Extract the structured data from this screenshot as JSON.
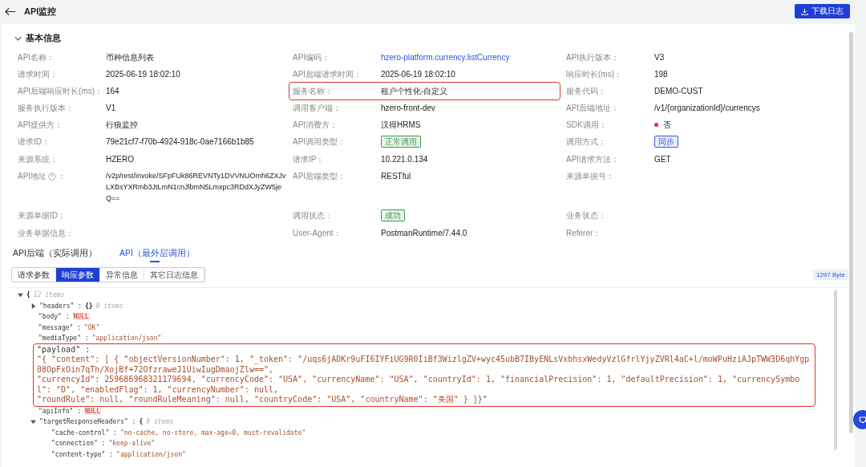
{
  "header": {
    "title": "API监控",
    "download_button": "下载日志"
  },
  "section": {
    "title": "基本信息",
    "expanded": true
  },
  "fields": [
    {
      "label": "API名称：",
      "value": "币种信息列表",
      "kind": "text"
    },
    {
      "label": "API编码：",
      "value": "hzero-platform.currency.listCurrency",
      "kind": "link"
    },
    {
      "label": "API执行版本：",
      "value": "V3",
      "kind": "text"
    },
    {
      "label": "请求时间：",
      "value": "2025-06-19 18:02:10",
      "kind": "text"
    },
    {
      "label": "API后端请求时间：",
      "value": "2025-06-19 18:02:10",
      "kind": "text"
    },
    {
      "label": "响应时长(ms)：",
      "value": "198",
      "kind": "text"
    },
    {
      "label": "API后端响应时长(ms)：",
      "value": "164",
      "kind": "text"
    },
    {
      "label": "服务名称：",
      "value": "租户个性化-自定义",
      "kind": "text",
      "highlighted": true
    },
    {
      "label": "服务代码：",
      "value": "DEMO-CUST",
      "kind": "text"
    },
    {
      "label": "服务执行版本：",
      "value": "V1",
      "kind": "text"
    },
    {
      "label": "调用客户端：",
      "value": "hzero-front-dev",
      "kind": "text"
    },
    {
      "label": "API后端地址：",
      "value": "/v1/{organizationId}/currencys",
      "kind": "text"
    },
    {
      "label": "API提供方：",
      "value": "行狼监控",
      "kind": "text"
    },
    {
      "label": "API消费方：",
      "value": "汉得HRMS",
      "kind": "text"
    },
    {
      "label": "SDK调用：",
      "value": "否",
      "kind": "dot",
      "color": "#e0245e"
    },
    {
      "label": "请求ID：",
      "value": "79e21cf7-f70b-4924-918c-0ae7166b1b85",
      "kind": "text"
    },
    {
      "label": "API调用类型：",
      "value": "正常调用",
      "kind": "tag",
      "color": "#3f9b4f"
    },
    {
      "label": "调用方式：",
      "value": "同步",
      "kind": "tag",
      "color": "#3b5bdb"
    },
    {
      "label": "来源系统：",
      "value": "HZERO",
      "kind": "text"
    },
    {
      "label": "请求IP：",
      "value": "10.221.0.134",
      "kind": "text"
    },
    {
      "label": "API请求方法：",
      "value": "GET",
      "kind": "text"
    },
    {
      "label": "API地址",
      "help": true,
      "label_end": "：",
      "value": "/v2p/rest/invoke/SFpFUk86REVNTy1DVVNUOmh6ZXJvLXBsYXRmb3JtLmN1cnJlbmN5Lmxpc3RDdXJyZW5jeQ==",
      "kind": "text"
    },
    {
      "label": "API后端类型：",
      "value": "RESTful",
      "kind": "text"
    },
    {
      "label": "来源单据号：",
      "kind": "text"
    },
    {
      "label": "来源单据ID：",
      "kind": "text"
    },
    {
      "label": "调用状态：",
      "value": "成功",
      "kind": "tag",
      "color": "#3f9b4f"
    },
    {
      "label": "业务状态：",
      "kind": "text"
    },
    {
      "label": "业务单据信息：",
      "kind": "text"
    },
    {
      "label": "User-Agent：",
      "value": "PostmanRuntime/7.44.0",
      "kind": "text"
    },
    {
      "label": "Referer：",
      "kind": "text"
    }
  ],
  "tabs": [
    {
      "label": "API后端（实际调用）",
      "selected": false
    },
    {
      "label": "API（最外层调用）",
      "selected": true
    }
  ],
  "segments": [
    {
      "label": "请求参数",
      "selected": false
    },
    {
      "label": "响应参数",
      "selected": true
    },
    {
      "label": "异常信息",
      "selected": false
    },
    {
      "label": "其它日志信息",
      "selected": false
    }
  ],
  "size_badge": "1297 Byte",
  "tree": {
    "kind": "object",
    "brace": "{",
    "count": "12 items",
    "expanded": true,
    "children": [
      {
        "kind": "object",
        "key": "\"headers\" :",
        "brace": "{}",
        "count": "0 items",
        "expanded": false
      },
      {
        "kind": "null",
        "key": "\"body\" :",
        "value": "NULL"
      },
      {
        "kind": "string",
        "key": "\"message\" :",
        "value": "\"OK\""
      },
      {
        "kind": "string",
        "key": "\"mediaType\" :",
        "value": "\"application/json\""
      },
      {
        "kind": "block",
        "key": "\"payload\" :",
        "highlighted": true,
        "lines": [
          "\"{ \"content\": [ { \"objectVersionNumber\": 1, \"_token\": \"/uqs6jADKr9uFI6IYFiUG9R0IiBf3WizlgZV+wyc45ubB7IByENLsVxbhsxWedyVzlGfrlYjyZVRl4aC+l/moWPuHziAJpTWW3D6qhYgp08OpFxOin7qTh/XojBf+72OfzraweJ1UiwIugDmaojZlw==\",",
          "\"currencyId\": 259686968321179694, \"currencyCode\": \"USA\", \"currencyName\": \"USA\", \"countryId\": 1, \"financialPrecision\": 1, \"defaultPrecision\": 1, \"currencySymbol\": \"D\", \"enabledFlag\": 1, \"currencyNumber\": null,",
          "\"roundRule\": null, \"roundRuleMeaning\": null, \"countryCode\": \"USA\", \"countryName\": \"美国\" } ]}\""
        ]
      },
      {
        "kind": "null",
        "key": "\"apiInfo\" :",
        "value": "NULL"
      },
      {
        "kind": "object",
        "key": "\"targetResponseHeaders\" :",
        "brace": "{",
        "count": "9 items",
        "expanded": true,
        "children": [
          {
            "kind": "string",
            "key": "\"cache-control\" :",
            "value": "\"no-cache, no-store, max-age=0, must-revalidate\""
          },
          {
            "kind": "string",
            "key": "\"connection\" :",
            "value": "\"keep-alive\""
          },
          {
            "kind": "string",
            "key": "\"content-type\" :",
            "value": "\"application/json\""
          }
        ]
      }
    ]
  }
}
